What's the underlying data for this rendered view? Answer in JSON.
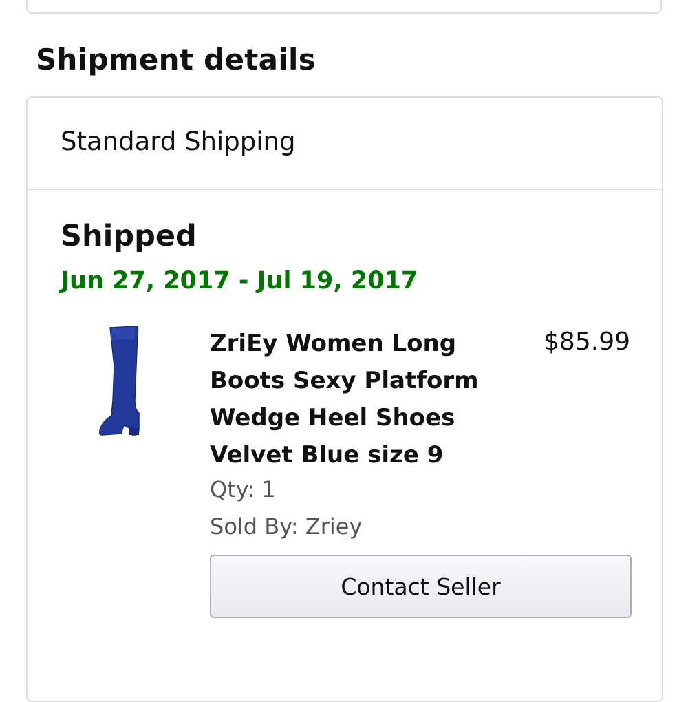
{
  "page": {
    "section_title": "Shipment details"
  },
  "shipment": {
    "method": "Standard Shipping",
    "status": "Shipped",
    "date_range": "Jun 27, 2017 - Jul 19, 2017",
    "status_color": "#007600"
  },
  "item": {
    "title": "ZriEy Women Long Boots Sexy Platform Wedge Heel Shoes Velvet Blue size 9",
    "price": "$85.99",
    "qty": "Qty: 1",
    "sold_by": "Sold By: Zriey",
    "image_icon": "blue-boot-image"
  },
  "actions": {
    "contact_seller_label": "Contact Seller"
  }
}
